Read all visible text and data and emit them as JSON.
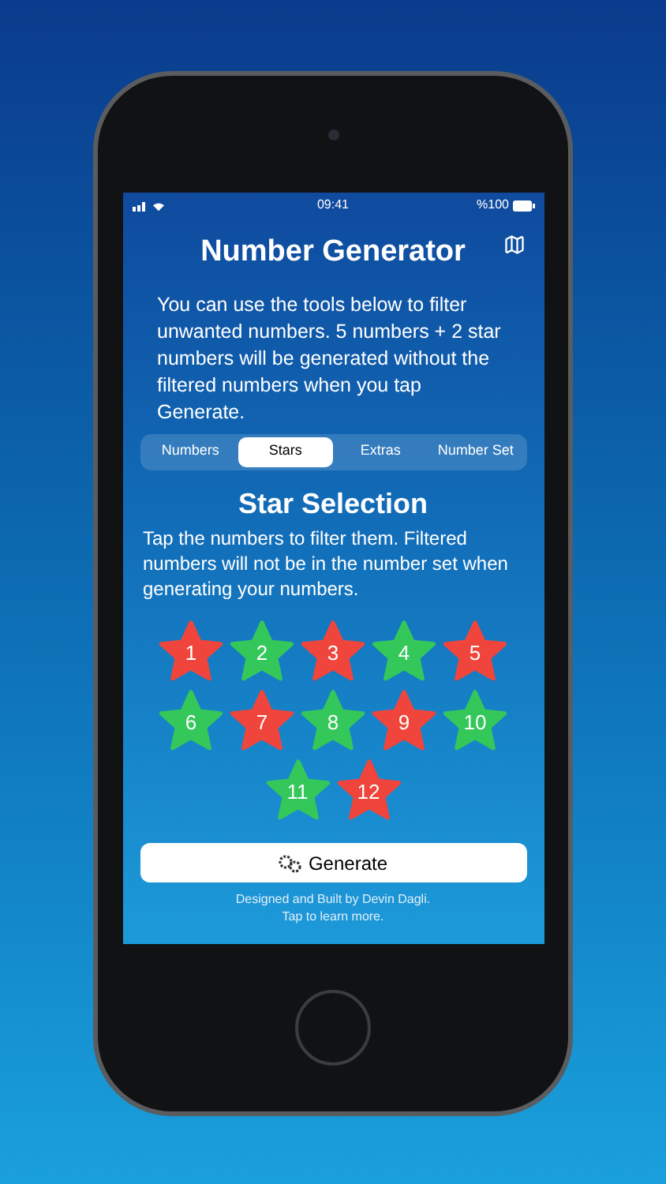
{
  "status_bar": {
    "time": "09:41",
    "battery": "%100"
  },
  "title": "Number Generator",
  "description": "You can use the tools below to filter unwanted numbers. 5 numbers + 2 star numbers will be generated without the filtered numbers when you tap Generate.",
  "tabs": [
    {
      "label": "Numbers",
      "selected": false
    },
    {
      "label": "Stars",
      "selected": true
    },
    {
      "label": "Extras",
      "selected": false
    },
    {
      "label": "Number Set",
      "selected": false
    }
  ],
  "section_title": "Star Selection",
  "instructions": "Tap the numbers to filter them. Filtered numbers will not be in the number set when generating your numbers.",
  "stars": [
    {
      "label": "1",
      "filtered": true
    },
    {
      "label": "2",
      "filtered": false
    },
    {
      "label": "3",
      "filtered": true
    },
    {
      "label": "4",
      "filtered": false
    },
    {
      "label": "5",
      "filtered": true
    },
    {
      "label": "6",
      "filtered": false
    },
    {
      "label": "7",
      "filtered": true
    },
    {
      "label": "8",
      "filtered": false
    },
    {
      "label": "9",
      "filtered": true
    },
    {
      "label": "10",
      "filtered": false
    },
    {
      "label": "11",
      "filtered": false
    },
    {
      "label": "12",
      "filtered": true
    }
  ],
  "generate_button": "Generate",
  "footer": [
    "Designed and Built by Devin Dagli.",
    "Tap to learn more."
  ]
}
